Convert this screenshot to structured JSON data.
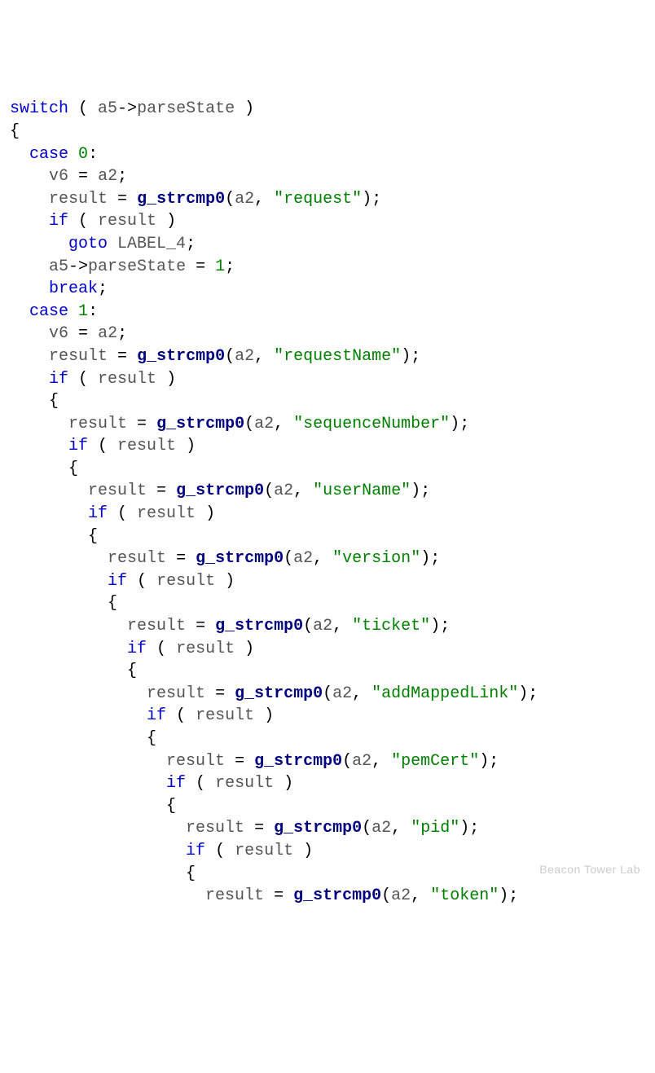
{
  "code": {
    "kw_switch": "switch",
    "kw_case": "case",
    "kw_if": "if",
    "kw_goto": "goto",
    "kw_break": "break",
    "field_parseState": "parseState",
    "var_a5": "a5",
    "var_a2": "a2",
    "var_v6": "v6",
    "var_result": "result",
    "fn_strcmp": "g_strcmp0",
    "label4": "LABEL_4",
    "num_0": "0",
    "num_1": "1",
    "str_request": "\"request\"",
    "str_requestName": "\"requestName\"",
    "str_sequenceNumber": "\"sequenceNumber\"",
    "str_userName": "\"userName\"",
    "str_version": "\"version\"",
    "str_ticket": "\"ticket\"",
    "str_addMappedLink": "\"addMappedLink\"",
    "str_pemCert": "\"pemCert\"",
    "str_pid": "\"pid\"",
    "str_token": "\"token\""
  },
  "watermark": "Beacon Tower Lab"
}
